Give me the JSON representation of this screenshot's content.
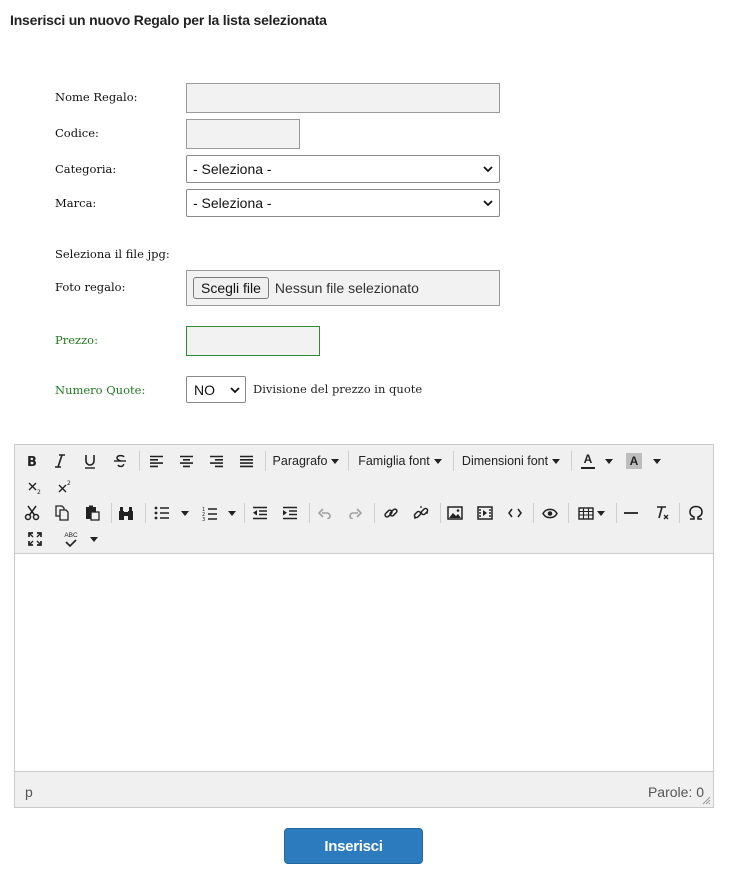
{
  "page_title": "Inserisci un nuovo Regalo per la lista selezionata",
  "form": {
    "nome_label": "Nome Regalo:",
    "nome_value": "",
    "codice_label": "Codice:",
    "codice_value": "",
    "categoria_label": "Categoria:",
    "categoria_selected": "- Seleziona -",
    "marca_label": "Marca:",
    "marca_selected": "- Seleziona -",
    "file_section_label": "Seleziona il file jpg:",
    "foto_label": "Foto regalo:",
    "file_button": "Scegli file",
    "file_status": "Nessun file selezionato",
    "prezzo_label": "Prezzo:",
    "prezzo_value": "",
    "quote_label": "Numero Quote:",
    "quote_selected": "NO",
    "quote_hint": "Divisione del prezzo in quote"
  },
  "editor": {
    "toolbar": {
      "paragraph_dropdown": "Paragrafo",
      "font_family_dropdown": "Famiglia font",
      "font_size_dropdown": "Dimensioni font",
      "text_color_letter": "A",
      "bg_color_letter": "A",
      "spellcheck_text": "ABC"
    },
    "content": "",
    "status_path": "p",
    "word_count": "Parole: 0"
  },
  "submit_label": "Inserisci",
  "colors": {
    "green_label": "#1f7a1f",
    "submit_bg": "#2d7bbf",
    "toolbar_bg": "#f0f0f0"
  }
}
